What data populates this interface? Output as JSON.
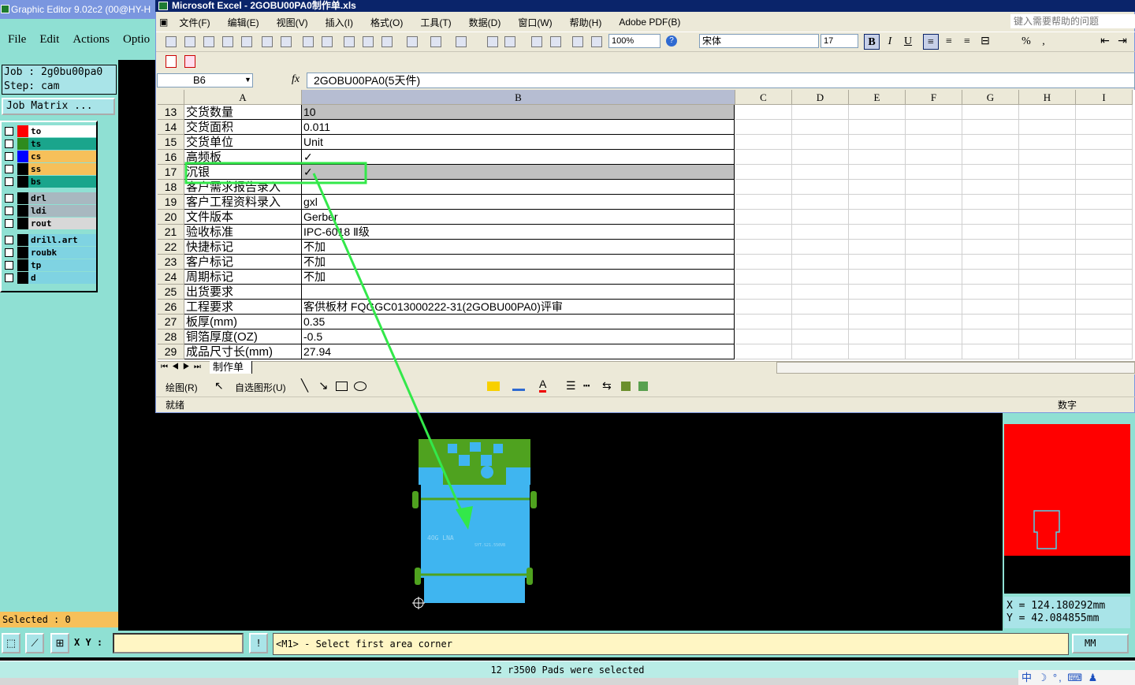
{
  "graphic_editor": {
    "title": "Graphic Editor 9.02c2 (00@HY-H",
    "menu": [
      "File",
      "Edit",
      "Actions",
      "Optio"
    ],
    "job": "Job : 2g0bu00pa0",
    "step": "Step: cam",
    "job_matrix": "Job Matrix ...",
    "layers": [
      {
        "name": "to",
        "swatch": "#ff0000",
        "bg": "#ffffff"
      },
      {
        "name": "ts",
        "swatch": "#2e8b1e",
        "bg": "#1aa58c"
      },
      {
        "name": "cs",
        "swatch": "#0000ff",
        "bg": "#f6c05a"
      },
      {
        "name": "ss",
        "swatch": "#000000",
        "bg": "#f6c05a"
      },
      {
        "name": "bs",
        "swatch": "#000000",
        "bg": "#1aa58c"
      },
      {
        "name": "drl",
        "swatch": "#000000",
        "bg": "#a8b8c0"
      },
      {
        "name": "ldi",
        "swatch": "#000000",
        "bg": "#a8b8c0"
      },
      {
        "name": "rout",
        "swatch": "#000000",
        "bg": "#d8d8d8"
      },
      {
        "name": "drill.art",
        "swatch": "#000000",
        "bg": "#7fd3e2"
      },
      {
        "name": "roubk",
        "swatch": "#000000",
        "bg": "#7fd3e2"
      },
      {
        "name": "tp",
        "swatch": "#000000",
        "bg": "#7fd3e2"
      },
      {
        "name": "d",
        "swatch": "#000000",
        "bg": "#7fd3e2"
      }
    ],
    "selected": "Selected : 0",
    "xy_label": "X Y :",
    "prompt": "<M1> - Select first area corner",
    "units": "MM",
    "status": "12 r3500 Pads were selected",
    "coord_x": "X = 124.180292mm",
    "coord_y": "Y = 42.084855mm",
    "pcb_text_1": "4OG LNA",
    "pcb_text_2": "SYT.S21.550VB"
  },
  "excel": {
    "title": "Microsoft Excel - 2GOBU00PA0制作单.xls",
    "menu": [
      "文件(F)",
      "编辑(E)",
      "视图(V)",
      "插入(I)",
      "格式(O)",
      "工具(T)",
      "数据(D)",
      "窗口(W)",
      "帮助(H)",
      "Adobe PDF(B)"
    ],
    "help_placeholder": "键入需要帮助的问题",
    "zoom": "100%",
    "font": "宋体",
    "font_size": "17",
    "bold": "B",
    "italic": "I",
    "underline": "U",
    "name_box": "B6",
    "fx": "fx",
    "formula": "2GOBU00PA0(5天件)",
    "columns": [
      "A",
      "B",
      "C",
      "D",
      "E",
      "F",
      "G",
      "H",
      "I"
    ],
    "rows": [
      {
        "num": "13",
        "a": "交货数量",
        "b": "10"
      },
      {
        "num": "14",
        "a": "交货面积",
        "b": "0.011"
      },
      {
        "num": "15",
        "a": "交货单位",
        "b": "Unit"
      },
      {
        "num": "16",
        "a": "高频板",
        "b": "✓"
      },
      {
        "num": "17",
        "a": "沉银",
        "b": "✓"
      },
      {
        "num": "18",
        "a": "客户需求报告录入",
        "b": ""
      },
      {
        "num": "19",
        "a": "客户工程资料录入",
        "b": "gxl"
      },
      {
        "num": "20",
        "a": "文件版本",
        "b": "Gerber"
      },
      {
        "num": "21",
        "a": "验收标准",
        "b": "IPC-6018 Ⅱ级"
      },
      {
        "num": "22",
        "a": "快捷标记",
        "b": "不加"
      },
      {
        "num": "23",
        "a": "客户标记",
        "b": "不加"
      },
      {
        "num": "24",
        "a": "周期标记",
        "b": "不加"
      },
      {
        "num": "25",
        "a": "出货要求",
        "b": ""
      },
      {
        "num": "26",
        "a": "工程要求",
        "b": "客供板材 FQGGC013000222-31(2GOBU00PA0)评审"
      },
      {
        "num": "27",
        "a": "板厚(mm)",
        "b": "0.35"
      },
      {
        "num": "28",
        "a": "铜箔厚度(OZ)",
        "b": "-0.5"
      },
      {
        "num": "29",
        "a": "成品尺寸长(mm)",
        "b": "27.94"
      }
    ],
    "sheet_tab": "制作单",
    "draw_label": "绘图(R)",
    "autoshape_label": "自选图形(U)",
    "status_ready": "就绪",
    "status_num": "数字"
  },
  "tray": "中 ☽ °, ⌨ ♟"
}
